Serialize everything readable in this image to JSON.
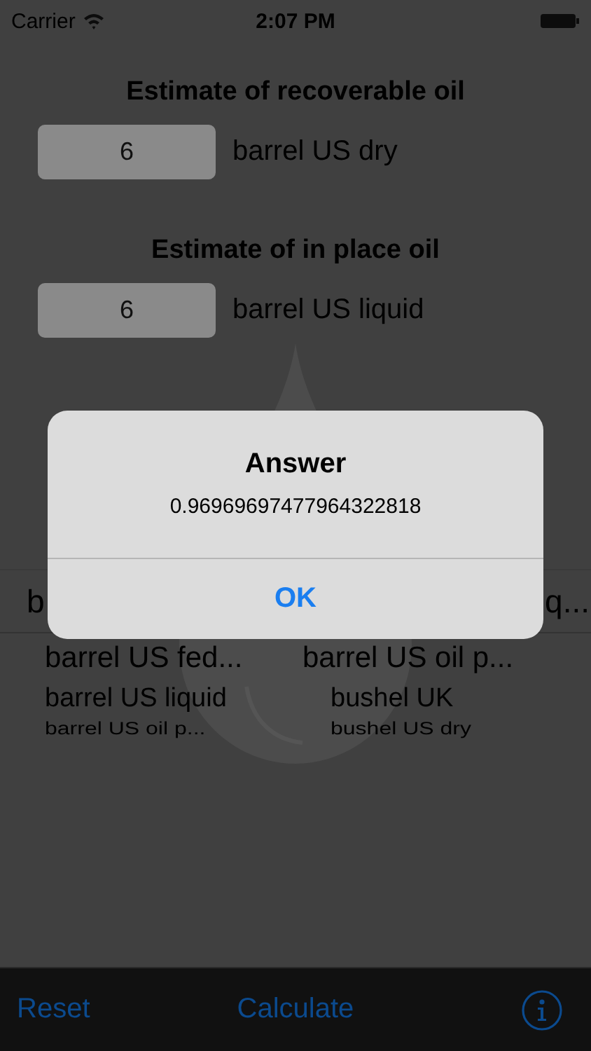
{
  "status_bar": {
    "carrier": "Carrier",
    "time": "2:07 PM"
  },
  "sections": [
    {
      "title": "Estimate of recoverable oil",
      "value": "6",
      "unit": "barrel US dry"
    },
    {
      "title": "Estimate of in place oil",
      "value": "6",
      "unit": "barrel US liquid"
    }
  ],
  "picker": {
    "selected_row": [
      "b",
      "q..."
    ],
    "rows": [
      [
        "barrel US fed...",
        "barrel US oil p..."
      ],
      [
        "barrel US liquid",
        "bushel UK"
      ],
      [
        "barrel US oil p...",
        "bushel US dry"
      ]
    ]
  },
  "alert": {
    "title": "Answer",
    "message": "0.96969697477964322818",
    "button": "OK"
  },
  "toolbar": {
    "left": "Reset",
    "center": "Calculate"
  }
}
